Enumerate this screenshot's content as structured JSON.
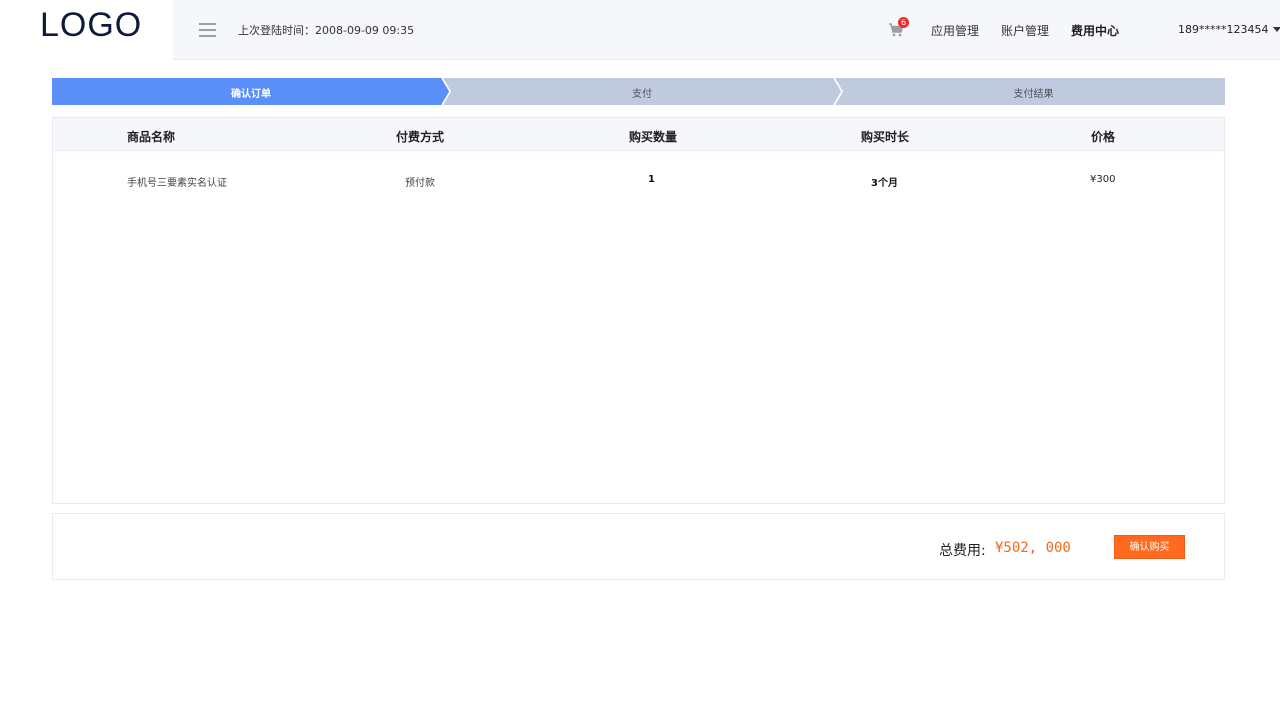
{
  "header": {
    "logo": "LOGO",
    "login_time": "上次登陆时间：2008-09-09 09:35",
    "cart_count": "6",
    "nav": {
      "app_manage": "应用管理",
      "account_manage": "账户管理",
      "billing_center": "费用中心"
    },
    "user": "189*****123454"
  },
  "steps": [
    {
      "label": "确认订单",
      "active": true
    },
    {
      "label": "支付",
      "active": false
    },
    {
      "label": "支付结果",
      "active": false
    }
  ],
  "table": {
    "columns": [
      "商品名称",
      "付费方式",
      "购买数量",
      "购买时长",
      "价格"
    ],
    "rows": [
      [
        "手机号三要素实名认证",
        "预付款",
        "1",
        "3个月",
        "¥300"
      ]
    ]
  },
  "footer": {
    "total_label": "总费用:",
    "total_value": "¥502, 000",
    "confirm_button": "确认购买"
  },
  "colors": {
    "step_active": "#5b8ff9",
    "step_inactive": "#c0cadf",
    "accent_orange": "#ff6a1f",
    "badge_red": "#ef2b2b"
  }
}
